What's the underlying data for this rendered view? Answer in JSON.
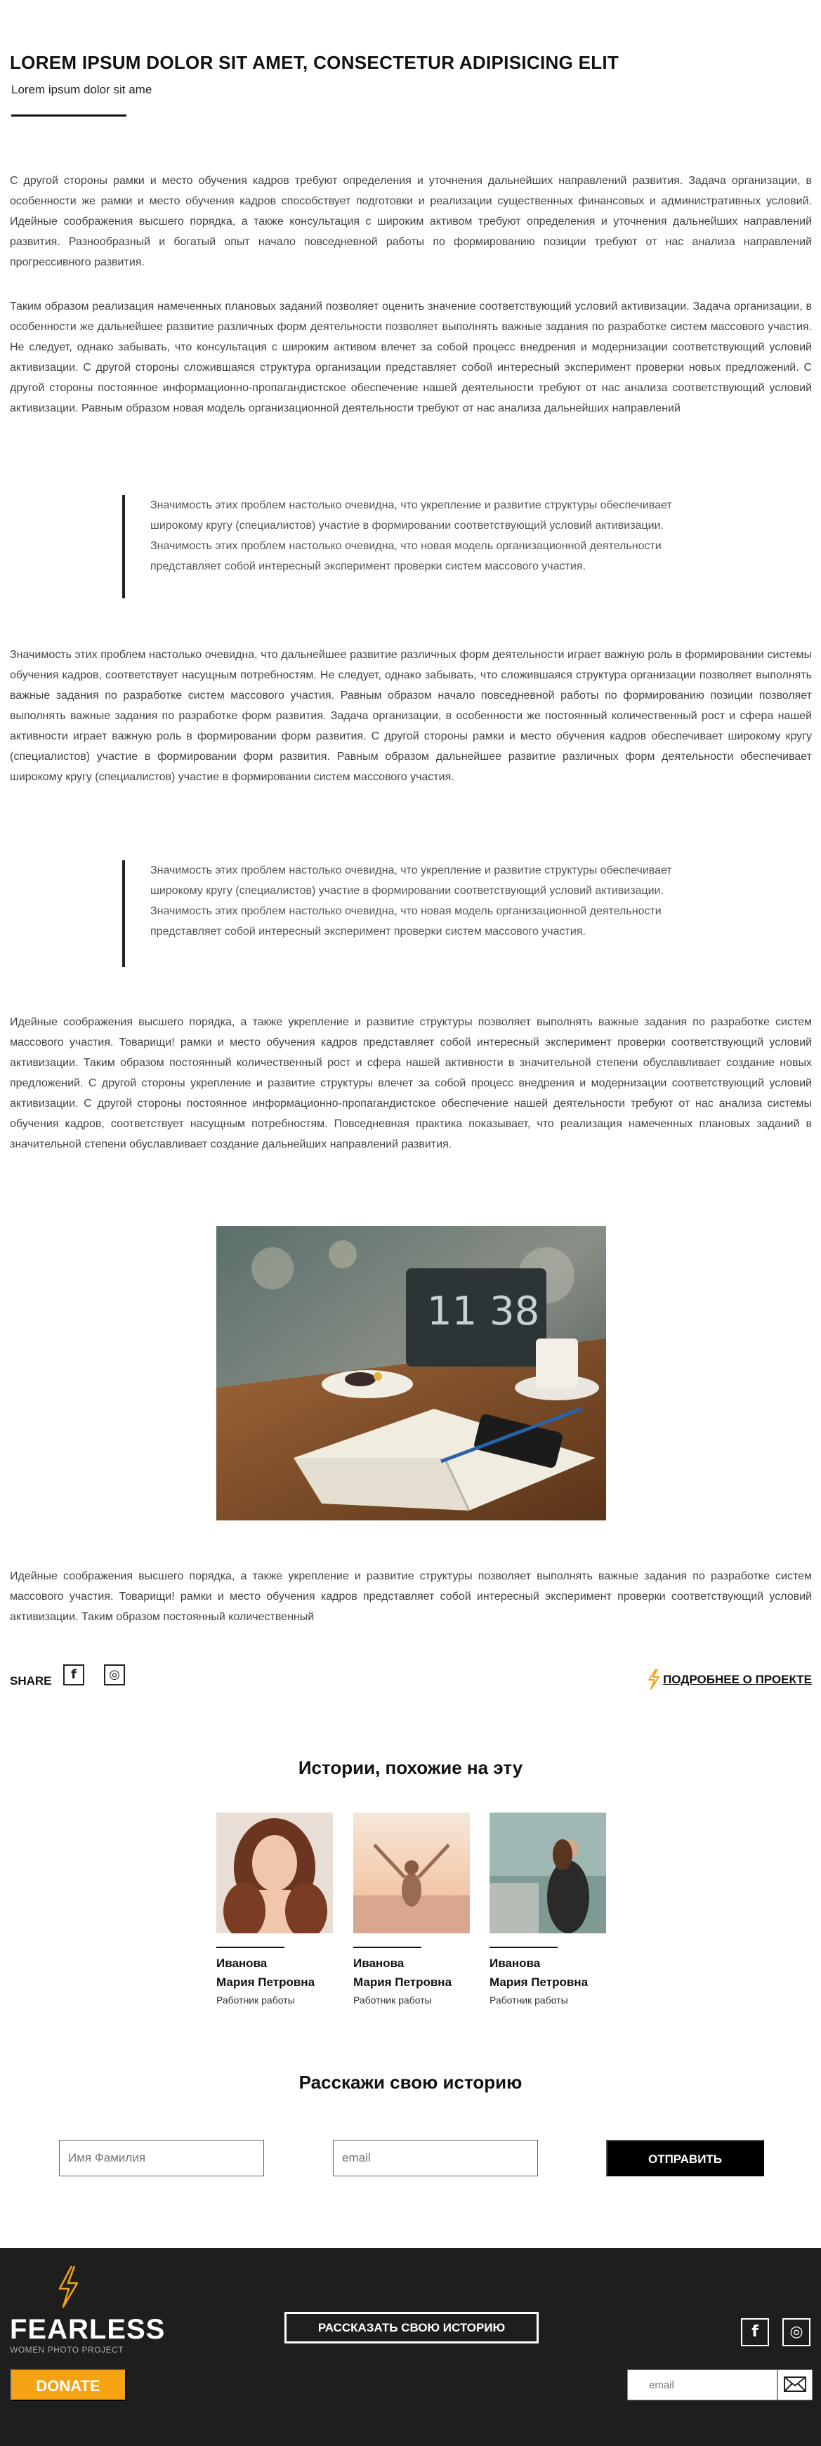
{
  "header": {
    "title": "LOREM IPSUM DOLOR SIT AMET,  CONSECTETUR ADIPISICING ELIT",
    "subtitle": "Lorem ipsum dolor sit ame"
  },
  "article": {
    "paragraphs": [
      "С другой стороны рамки и место обучения кадров требуют определения и уточнения дальнейших направлений развития. Задача организации, в особенности же рамки и место обучения кадров способствует подготовки и реализации существенных финансовых и административных условий. Идейные соображения высшего порядка, а также консультация с широким активом требуют определения и уточнения дальнейших направлений развития. Разнообразный и богатый опыт начало повседневной работы по формированию позиции требуют от нас анализа направлений прогрессивного развития.",
      "Таким образом реализация намеченных плановых заданий позволяет оценить значение соответствующий условий активизации. Задача организации, в особенности же дальнейшее развитие различных форм деятельности позволяет выполнять важные задания по разработке систем массового участия. Не следует, однако забывать, что консультация с широким активом влечет за собой процесс внедрения и модернизации соответствующий условий активизации. С другой стороны сложившаяся структура организации представляет собой интересный эксперимент проверки новых предложений. С другой стороны постоянное информационно-пропагандистское обеспечение нашей деятельности требуют от нас анализа соответствующий условий активизации. Равным образом новая модель организационной деятельности требуют от нас анализа дальнейших направлений",
      "Значимость этих проблем настолько очевидна, что дальнейшее развитие различных форм деятельности играет важную роль в формировании системы обучения кадров, соответствует насущным потребностям. Не следует, однако забывать, что сложившаяся структура организации позволяет выполнять важные задания по разработке систем массового участия. Равным образом начало повседневной работы по формированию позиции позволяет выполнять важные задания по разработке форм развития. Задача организации, в особенности же постоянный количественный рост и сфера нашей активности играет важную роль в формировании форм развития. С другой стороны рамки и место обучения кадров обеспечивает широкому кругу (специалистов) участие в формировании форм развития. Равным образом дальнейшее развитие различных форм деятельности обеспечивает широкому кругу (специалистов) участие в формировании систем массового участия.",
      "Идейные соображения высшего порядка, а также укрепление и развитие структуры позволяет выполнять важные задания по разработке систем массового участия. Товарищи! рамки и место обучения кадров представляет собой интересный эксперимент проверки соответствующий условий активизации. Таким образом постоянный количественный рост и сфера нашей активности в значительной степени обуславливает создание новых предложений. С другой стороны укрепление и развитие структуры влечет за собой процесс внедрения и модернизации соответствующий условий активизации. С другой стороны постоянное информационно-пропагандистское обеспечение нашей деятельности требуют от нас анализа системы обучения кадров, соответствует насущным потребностям. Повседневная практика показывает, что реализация намеченных плановых заданий в значительной степени обуславливает создание дальнейших направлений развития.",
      "Идейные соображения высшего порядка, а также укрепление и развитие структуры позволяет выполнять важные задания по разработке систем массового участия. Товарищи! рамки и место обучения кадров представляет собой интересный эксперимент проверки соответствующий условий активизации. Таким образом постоянный количественный"
    ],
    "quotes": [
      "Значимость этих проблем настолько очевидна, что укрепление и развитие структуры обеспечивает широкому кругу (специалистов) участие в формировании соответствующий условий активизации. Значимость этих проблем настолько очевидна, что новая модель организационной деятельности представляет собой интересный эксперимент проверки систем массового участия.",
      "Значимость этих проблем настолько очевидна, что укрепление и развитие структуры обеспечивает широкому кругу (специалистов) участие в формировании соответствующий условий активизации. Значимость этих проблем настолько очевидна, что новая модель организационной деятельности представляет собой интересный эксперимент проверки систем массового участия."
    ],
    "photo_clock": "11 38"
  },
  "share": {
    "label": "SHARE",
    "facebook_icon": "f",
    "instagram_icon": "◎",
    "more_link": "ПОДРОБНЕЕ О ПРОЕКТЕ"
  },
  "stories": {
    "title": "Истории, похожие на эту",
    "items": [
      {
        "surname": "Иванова",
        "given": "Мария Петровна",
        "role": "Работник работы"
      },
      {
        "surname": "Иванова",
        "given": "Мария Петровна",
        "role": "Работник работы"
      },
      {
        "surname": "Иванова",
        "given": "Мария Петровна",
        "role": "Работник работы"
      }
    ]
  },
  "form": {
    "title": "Расскажи свою историю",
    "name_placeholder": "Имя Фамилия",
    "email_placeholder": "email",
    "submit_label": "ОТПРАВИТЬ"
  },
  "footer": {
    "logo": "FEARLESS",
    "logo_sub": "WOMEN PHOTO PROJECT",
    "tell_story_label": "РАССКАЗАТЬ СВОЮ ИСТОРИЮ",
    "donate_label": "DONATE",
    "email_placeholder": "email",
    "facebook_icon": "f",
    "instagram_icon": "◎"
  },
  "colors": {
    "accent": "#f5a312",
    "footer_bg": "#1e1e1e"
  }
}
